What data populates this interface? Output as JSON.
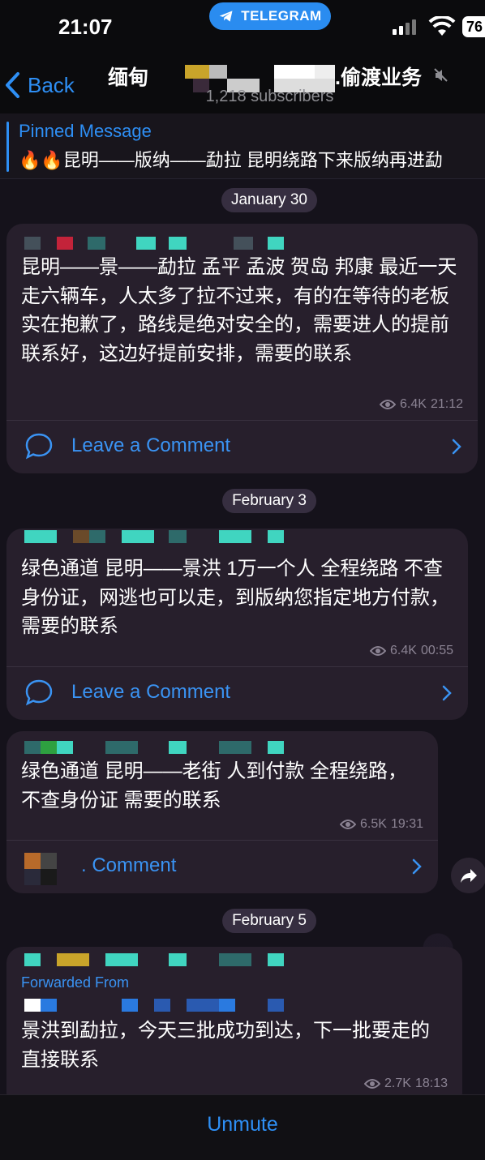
{
  "status_bar": {
    "time": "21:07",
    "app_pill": "TELEGRAM",
    "battery": "76"
  },
  "header": {
    "back_label": "Back",
    "title_prefix": "缅甸",
    "title_suffix": ".偷渡业务",
    "subscribers": "1,218 subscribers"
  },
  "pinned": {
    "label": "Pinned Message",
    "text": "🔥🔥昆明——版纳——勐拉 昆明绕路下来版纳再进勐"
  },
  "messages": [
    {
      "date": "January 30",
      "text": "昆明——景——勐拉 孟平 孟波 贺岛 邦康 最近一天走六辆车，人太多了拉不过来，有的在等待的老板实在抱歉了，路线是绝对安全的，需要进人的提前联系好，这边好提前安排，需要的联系",
      "views": "6.4K",
      "time": "21:12",
      "comment": "Leave a Comment"
    },
    {
      "date": "February 3",
      "text": "绿色通道 昆明——景洪 1万一个人  全程绕路 不查身份证，网逃也可以走，到版纳您指定地方付款， 需要的联系",
      "views": "6.4K",
      "time": "00:55",
      "comment": "Leave a Comment"
    },
    {
      "text": "绿色通道 昆明——老街 人到付款 全程绕路，不查身份证 需要的联系",
      "views": "6.5K",
      "time": "19:31",
      "comment": ". Comment"
    },
    {
      "date": "February 5",
      "forwarded": "Forwarded From",
      "text": "景洪到勐拉，今天三批成功到达，下一批要走的直接联系",
      "views": "2.7K",
      "time": "18:13"
    }
  ],
  "bottom": {
    "unmute": "Unmute"
  },
  "colors": {
    "accent": "#2e8ff5",
    "bubble": "#271f2c",
    "background": "#15121b"
  },
  "icons": [
    "telegram-icon",
    "signal-icon",
    "wifi-icon",
    "back-chevron-icon",
    "mute-icon",
    "eye-icon",
    "comment-icon",
    "chevron-right-icon",
    "share-icon"
  ]
}
